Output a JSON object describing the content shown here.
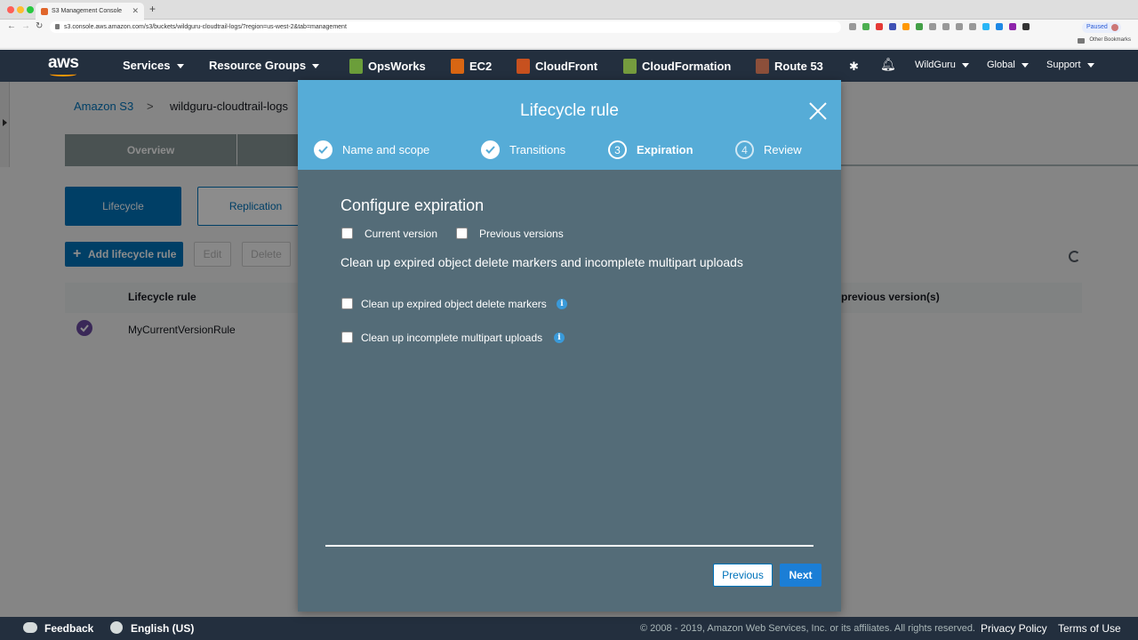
{
  "browser": {
    "tab_title": "S3 Management Console",
    "url": "s3.console.aws.amazon.com/s3/buckets/wildguru-cloudtrail-logs/?region=us-west-2&tab=management",
    "paused_label": "Paused",
    "bookmarks_label": "Other Bookmarks"
  },
  "aws_nav": {
    "logo": "aws",
    "services": "Services",
    "resource_groups": "Resource Groups",
    "shortcuts": [
      {
        "label": "OpsWorks",
        "color": "#6b9e3a"
      },
      {
        "label": "EC2",
        "color": "#d86613"
      },
      {
        "label": "CloudFront",
        "color": "#c7511f"
      },
      {
        "label": "CloudFormation",
        "color": "#759c3e"
      },
      {
        "label": "Route 53",
        "color": "#8c4f3a"
      }
    ],
    "user": "WildGuru",
    "region": "Global",
    "support": "Support"
  },
  "background": {
    "breadcrumb_home": "Amazon S3",
    "breadcrumb_sep": ">",
    "breadcrumb_bucket": "wildguru-cloudtrail-logs",
    "tab_overview": "Overview",
    "pill_lifecycle": "Lifecycle",
    "pill_replication": "Replication",
    "add_rule": "Add lifecycle rule",
    "edit": "Edit",
    "delete": "Delete",
    "col_lifecycle": "Lifecycle rule",
    "col_previous": "previous version(s)",
    "row_rule": "MyCurrentVersionRule"
  },
  "modal": {
    "title": "Lifecycle rule",
    "steps": [
      {
        "num": "1",
        "label": "Name and scope",
        "state": "done"
      },
      {
        "num": "2",
        "label": "Transitions",
        "state": "done"
      },
      {
        "num": "3",
        "label": "Expiration",
        "state": "active"
      },
      {
        "num": "4",
        "label": "Review",
        "state": "pending"
      }
    ],
    "section_title": "Configure expiration",
    "current_version": "Current version",
    "previous_versions": "Previous versions",
    "cleanup_title": "Clean up expired object delete markers and incomplete multipart uploads",
    "cleanup_delete_markers": "Clean up expired object delete markers",
    "cleanup_multipart": "Clean up incomplete multipart uploads",
    "info_glyph": "i",
    "previous_button": "Previous",
    "next_button": "Next"
  },
  "footer": {
    "feedback": "Feedback",
    "language": "English (US)",
    "copyright": "© 2008 - 2019, Amazon Web Services, Inc. or its affiliates. All rights reserved.",
    "privacy": "Privacy Policy",
    "terms": "Terms of Use"
  },
  "colors": {
    "nav_bg": "#232f3e",
    "modal_header": "#56acd7",
    "modal_body": "#546c78",
    "primary": "#0073bb",
    "radio_selected": "#6b4aa0"
  }
}
